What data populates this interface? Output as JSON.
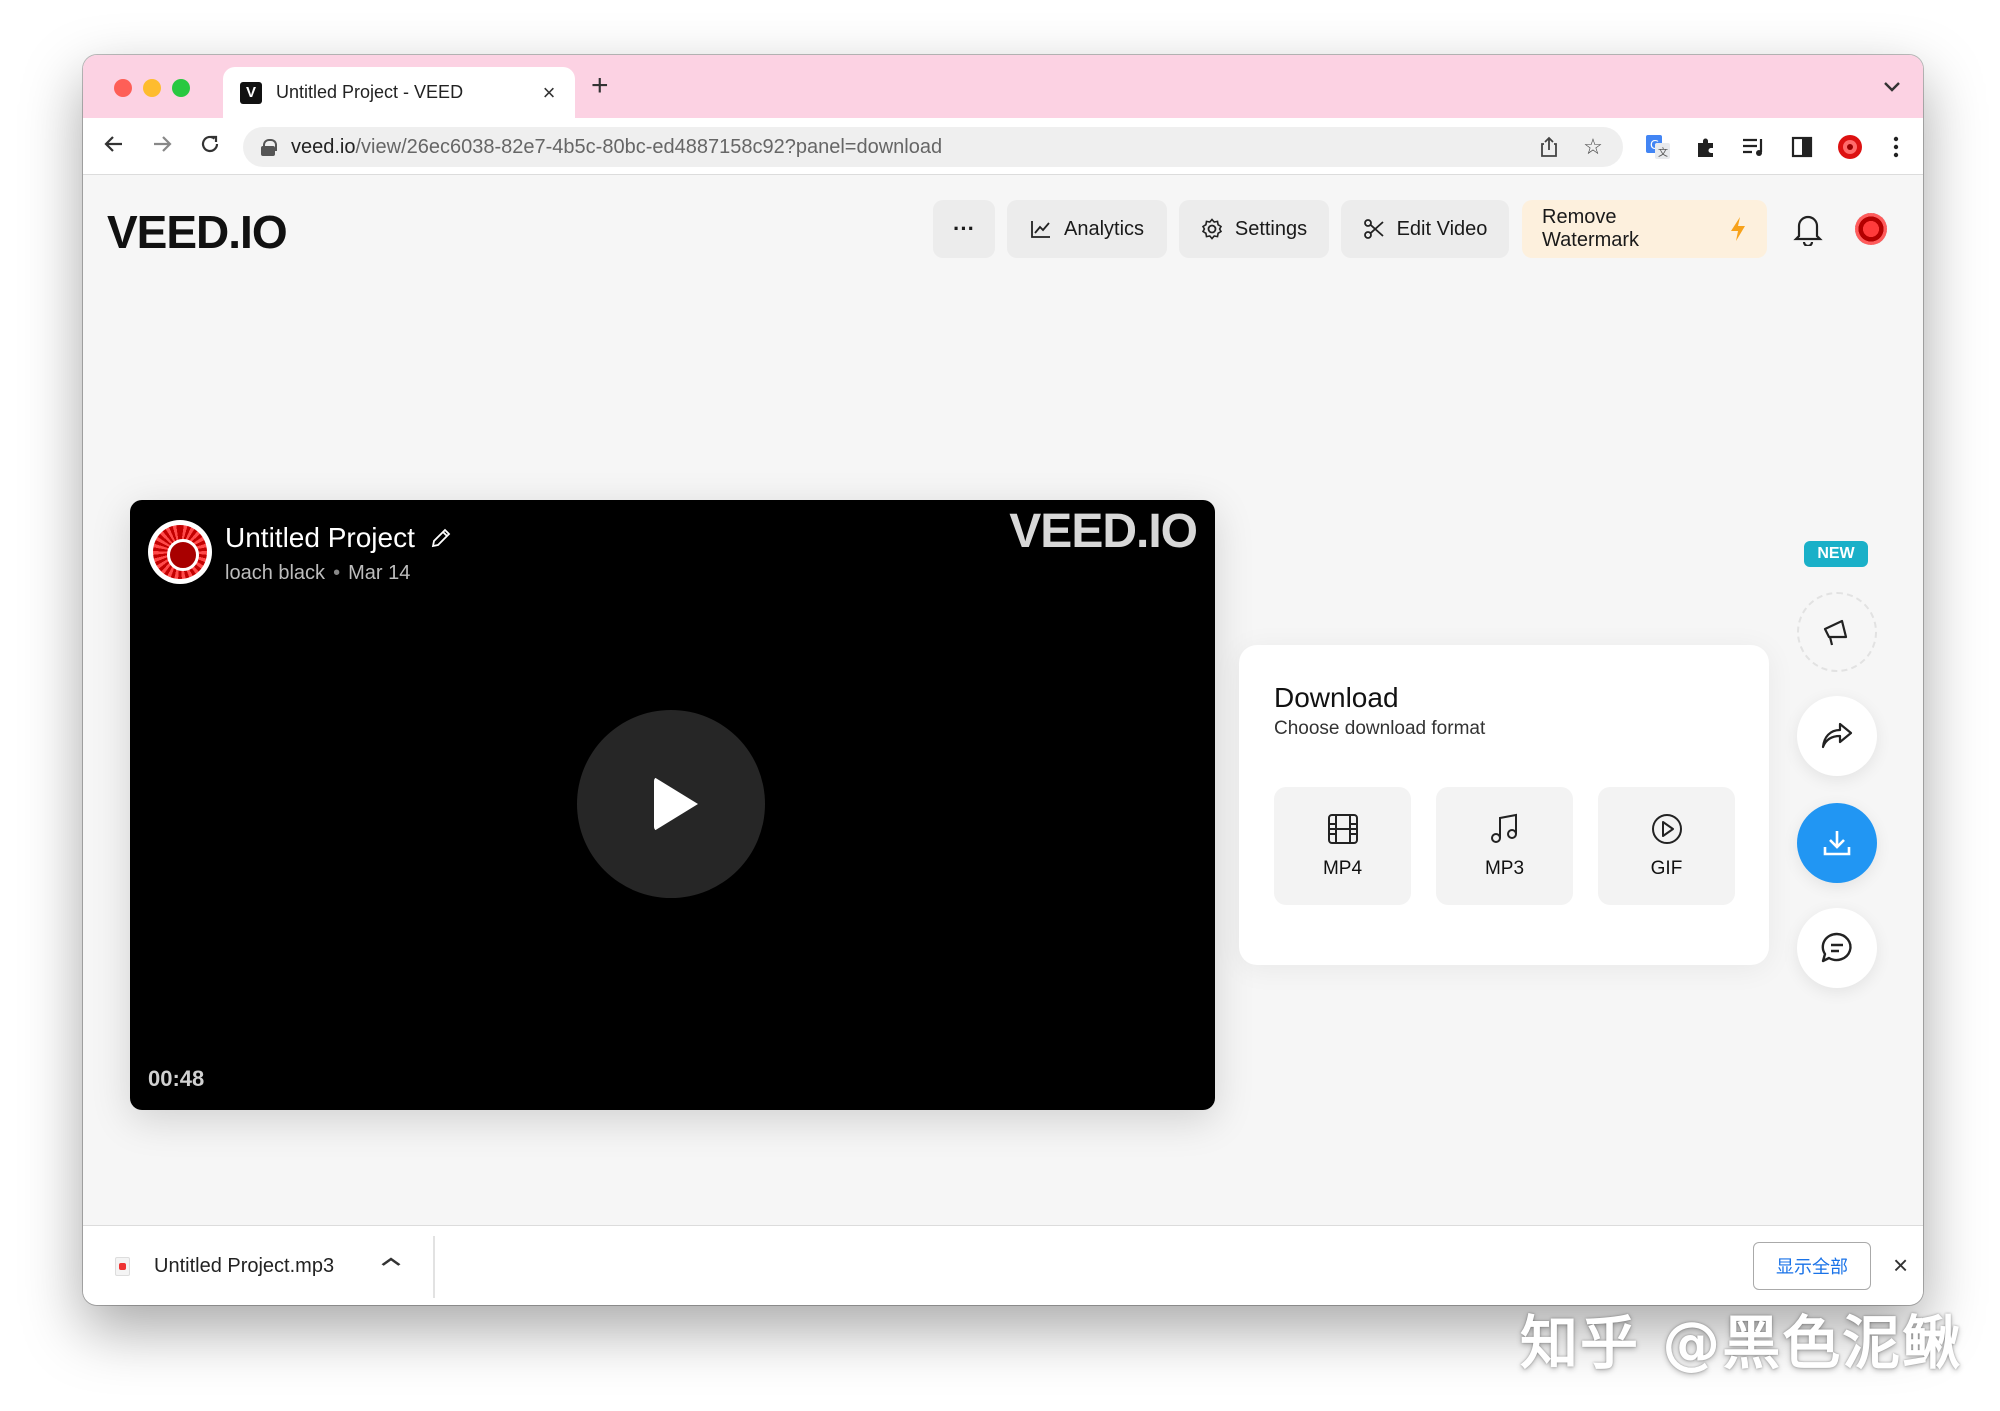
{
  "browser": {
    "tab_title": "Untitled Project - VEED",
    "tab_favicon": "V",
    "url_host": "veed.io",
    "url_rest": "/view/26ec6038-82e7-4b5c-80bc-ed4887158c92?panel=download"
  },
  "header": {
    "logo": "VEED.IO",
    "more_label": "···",
    "analytics_label": "Analytics",
    "settings_label": "Settings",
    "edit_label": "Edit Video",
    "watermark_label": "Remove Watermark"
  },
  "video": {
    "title": "Untitled Project",
    "author": "loach black",
    "date": "Mar 14",
    "watermark": "VEED.IO",
    "duration": "00:48"
  },
  "download": {
    "title": "Download",
    "subtitle": "Choose download format",
    "formats": [
      {
        "label": "MP4",
        "icon": "film-icon"
      },
      {
        "label": "MP3",
        "icon": "music-note-icon"
      },
      {
        "label": "GIF",
        "icon": "play-square-icon"
      }
    ]
  },
  "side": {
    "new_badge": "NEW"
  },
  "shelf": {
    "file_name": "Untitled Project.mp3",
    "show_all": "显示全部"
  },
  "overlay": {
    "watermark": "知乎 @黑色泥鳅"
  },
  "colors": {
    "titlebar": "#fcd2e3",
    "accent_blue": "#2196f3",
    "watermark_btn": "#fdf0dd",
    "badge": "#1ab0c8"
  }
}
